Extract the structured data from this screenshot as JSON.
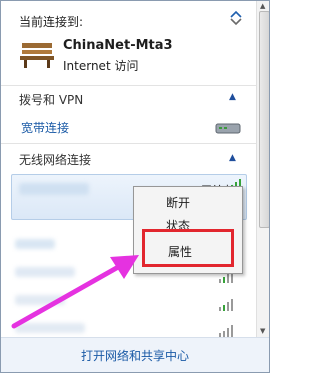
{
  "panel": {
    "currently_connected_label": "当前连接到:",
    "connected_network": {
      "name": "ChinaNet-Mta3",
      "access": "Internet 访问"
    },
    "sections": [
      {
        "title": "拨号和 VPN"
      },
      {
        "title": "无线网络连接"
      }
    ],
    "dialup_item": {
      "label": "宽带连接"
    },
    "wifi_selected": {
      "status": "已连接"
    },
    "context_menu": {
      "items": [
        "断开",
        "状态",
        "属性"
      ]
    },
    "footer_link": "打开网络和共享中心"
  },
  "colors": {
    "highlight_red": "#e2262e",
    "arrow_magenta": "#e532e0",
    "link_blue": "#1a5aa6",
    "signal_green": "#37a33a"
  },
  "icons": [
    "refresh-icon",
    "bench-network-icon",
    "modem-icon",
    "signal-icon",
    "collapse-caret-icon",
    "pointer-arrow"
  ]
}
